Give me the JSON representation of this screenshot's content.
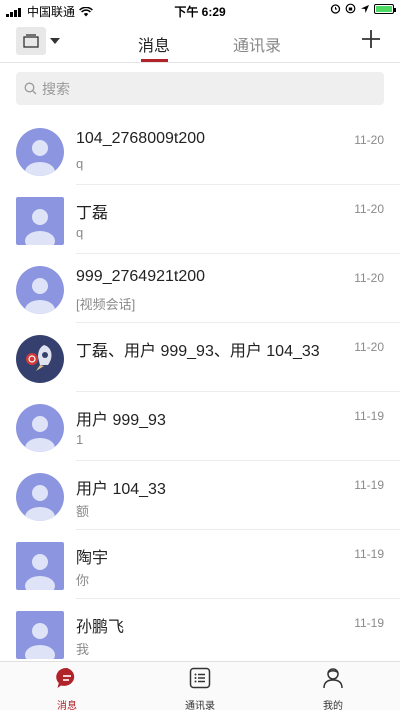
{
  "status": {
    "carrier": "中国联通",
    "time": "下午 6:29"
  },
  "header": {
    "tabs": [
      {
        "label": "消息"
      },
      {
        "label": "通讯录"
      }
    ]
  },
  "search": {
    "placeholder": "搜索"
  },
  "conversations": [
    {
      "name": "104_2768009t200",
      "preview": "q",
      "date": "11-20"
    },
    {
      "name": "丁磊",
      "preview": "q",
      "date": "11-20"
    },
    {
      "name": "999_2764921t200",
      "preview": "[视频会话]",
      "date": "11-20"
    },
    {
      "name": "丁磊、用户 999_93、用户 104_33",
      "preview": "",
      "date": "11-20"
    },
    {
      "name": "用户 999_93",
      "preview": "1",
      "date": "11-19"
    },
    {
      "name": "用户 104_33",
      "preview": "额",
      "date": "11-19"
    },
    {
      "name": "陶宇",
      "preview": "你",
      "date": "11-19"
    },
    {
      "name": "孙鹏飞",
      "preview": "我",
      "date": "11-19"
    }
  ],
  "bottom_nav": [
    {
      "label": "消息"
    },
    {
      "label": "通讯录"
    },
    {
      "label": "我的"
    }
  ],
  "colors": {
    "accent": "#b1232a",
    "avatar": "#8c96e0",
    "avatar_light": "#dfe3f7"
  }
}
